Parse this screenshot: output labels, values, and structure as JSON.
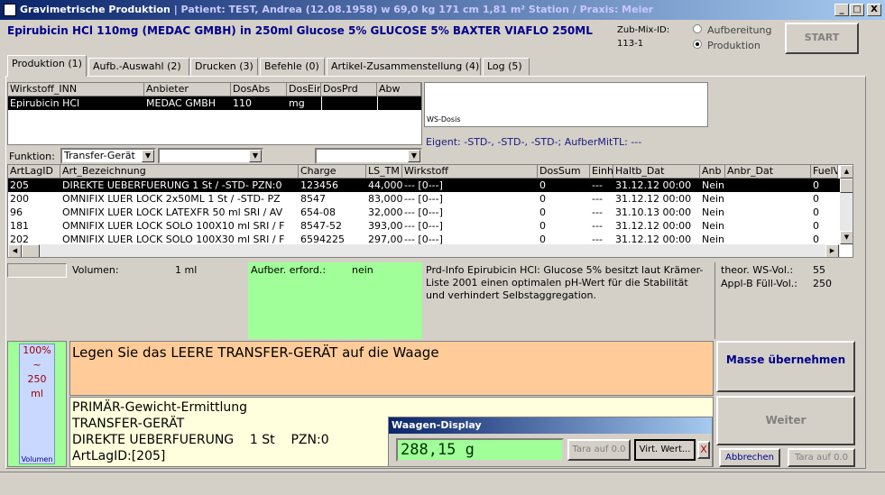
{
  "window": {
    "title": "Gravimetrische Produktion",
    "subtitle": " |  Patient: TEST, Andrea (12.08.1958) w 69,0 kg  171 cm  1,81 m² Station / Praxis: Meier",
    "min": "_",
    "max": "□",
    "close": "X"
  },
  "header": {
    "drug": "Epirubicin HCl 110mg (MEDAC GMBH) in 250ml Glucose 5% GLUCOSE 5% BAXTER VIAFLO 250ML",
    "zubmix_label": "Zub-Mix-ID:",
    "zubmix_value": "113-1",
    "radio_aufbereitung": "Aufbereitung",
    "radio_produktion": "Produktion",
    "start": "START"
  },
  "tabs": [
    {
      "label": "Produktion (1)"
    },
    {
      "label": "Aufb.-Auswahl (2)"
    },
    {
      "label": "Drucken (3)"
    },
    {
      "label": "Befehle (0)"
    },
    {
      "label": "Artikel-Zusammenstellung (4)"
    },
    {
      "label": "Log (5)"
    }
  ],
  "wirkstoff_table": {
    "headers": [
      "Wirkstoff_INN",
      "Anbieter",
      "DosAbs",
      "DosEin",
      "DosPrd",
      "Abw"
    ],
    "rows": [
      [
        "Epirubicin HCl",
        "MEDAC GMBH",
        "110",
        "mg",
        "",
        ""
      ]
    ]
  },
  "ws_dosis_label": "WS-Dosis",
  "eigent": "Eigent: -STD-, -STD-, -STD-; AufberMitTL: ---",
  "funktion": {
    "label": "Funktion:",
    "value": "Transfer-Gerät"
  },
  "artikel_table": {
    "headers": [
      "ArtLagID",
      "Art_Bezeichnung",
      "Charge",
      "LS_TM",
      "Wirkstoff",
      "DosSum",
      "Einh",
      "Haltb_Dat",
      "Anb",
      "Anbr_Dat",
      "FuelV"
    ],
    "rows": [
      [
        "205",
        "DIREKTE UEBERFUERUNG   1 St   / -STD- PZN:0",
        "123456",
        "44,000",
        "--- [0---]",
        "0",
        "---",
        "31.12.12 00:00",
        "Nein",
        "",
        "0"
      ],
      [
        "200",
        "OMNIFIX LUER LOCK 2x50ML   1 St   / -STD- PZ",
        "8547",
        "83,000",
        "--- [0---]",
        "0",
        "---",
        "31.12.12 00:00",
        "Nein",
        "",
        "0"
      ],
      [
        "96",
        "OMNIFIX LUER LOCK LATEXFR   50 ml SRI   / AV",
        "654-08",
        "32,000",
        "--- [0---]",
        "0",
        "---",
        "31.10.13 00:00",
        "Nein",
        "",
        "0"
      ],
      [
        "181",
        "OMNIFIX LUER LOCK SOLO   100X10 ml SRI   / F",
        "8547-52",
        "393,000",
        "--- [0---]",
        "0",
        "---",
        "31.12.12 00:00",
        "Nein",
        "",
        "0"
      ],
      [
        "202",
        "OMNIFIX LUER LOCK SOLO   100X30 ml SRI   / F",
        "6594225",
        "297,000",
        "--- [0---]",
        "0",
        "---",
        "31.12.12 00:00",
        "Nein",
        "",
        "0"
      ]
    ]
  },
  "info": {
    "volumen_label": "Volumen:",
    "volumen_value": "1 ml",
    "aufber_label": "Aufber. erford.:",
    "aufber_value": "nein",
    "prd_info": "Prd-Info Epirubicin HCl: Glucose 5% besitzt laut Krämer-Liste 2001 einen optimalen pH-Wert für die Stabilität und verhindert Selbstaggregation.",
    "theor_label": "theor. WS-Vol.:",
    "theor_value": "55",
    "applb_label": "Appl-B Füll-Vol.:",
    "applb_value": "250"
  },
  "volume_bar": {
    "percent": "100%",
    "tilde": "~",
    "ml": "250",
    "unit": "ml",
    "caption": "Volumen",
    "fill_fraction": 1.0
  },
  "instruction": "Legen Sie das LEERE TRANSFER-GERÄT auf die Waage",
  "details": [
    "PRIMÄR-Gewicht-Ermittlung",
    "TRANSFER-GERÄT",
    "DIREKTE UEBERFUERUNG    1 St    PZN:0",
    "ArtLagID:[205]"
  ],
  "buttons": {
    "masse": "Masse übernehmen",
    "weiter": "Weiter",
    "abbrechen": "Abbrechen",
    "tara": "Tara auf 0.0"
  },
  "waage": {
    "title": "Waagen-Display",
    "value": "288,15 g",
    "tara": "Tara auf 0.0",
    "virt": "Virt. Wert...",
    "close": "X"
  }
}
